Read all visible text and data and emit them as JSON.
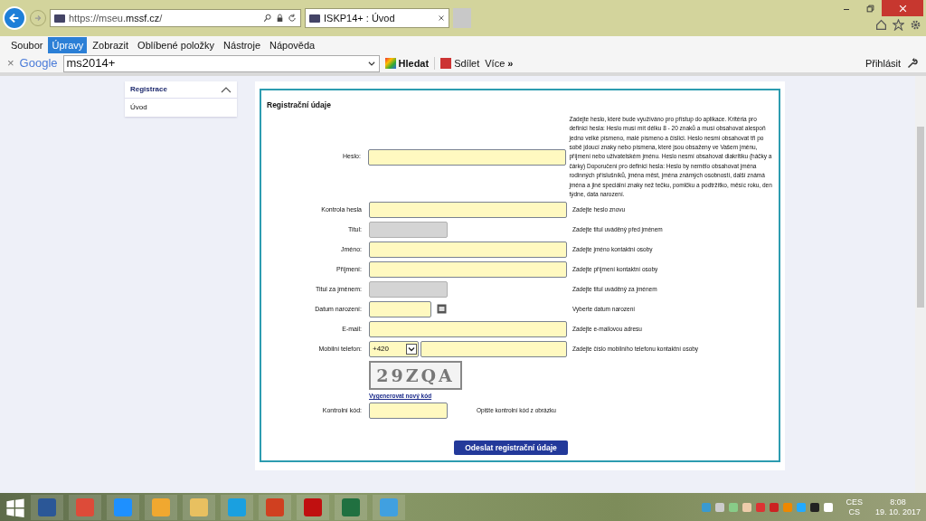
{
  "browser": {
    "url_prefix": "https://mseu.",
    "url_domain": "mssf.cz",
    "url_suffix": "/",
    "tab_title": "ISKP14+ : Úvod",
    "menu": [
      {
        "label": "Soubor",
        "selected": false
      },
      {
        "label": "Úpravy",
        "selected": true
      },
      {
        "label": "Zobrazit",
        "selected": false
      },
      {
        "label": "Oblíbené položky",
        "selected": false
      },
      {
        "label": "Nástroje",
        "selected": false
      },
      {
        "label": "Nápověda",
        "selected": false
      }
    ],
    "toolbar": {
      "close": "×",
      "brand": "Google",
      "query": "ms2014+",
      "search": "Hledat",
      "share": "Sdílet",
      "more": "Více",
      "more_arrows": "»",
      "login": "Přihlásit"
    }
  },
  "sidebar": {
    "title": "Registrace",
    "expanded": true,
    "items": [
      "Úvod"
    ]
  },
  "form": {
    "title": "Registrační údaje",
    "fields": [
      {
        "kind": "text",
        "label": "Heslo:",
        "help": "Zadejte heslo, které bude využíváno pro přístup do aplikace. Kritéria pro definici hesla: Heslo musí mít délku 8 - 20 znaků a musí obsahovat alespoň jedno velké písmeno, malé písmeno a číslici. Heslo nesmí obsahovat tři po sobě jdoucí znaky nebo písmena, které jsou obsaženy ve Vašem jménu, příjmení nebo uživatelském jménu. Heslo nesmí obsahovat diakritiku (háčky a čárky) Doporučení pro definici hesla: Heslo by nemělo obsahovat jména rodinných příslušníků, jména měst, jména známých osobností, další známá jména a jiné speciální znaky než tečku, pomlčku a podtržítko, měsíc roku, den týdne, data narození."
      },
      {
        "kind": "text",
        "label": "Kontrola hesla",
        "help": "Zadejte heslo znovu"
      },
      {
        "kind": "disabled",
        "label": "Titul:",
        "help": "Zadejte titul uváděný před jménem"
      },
      {
        "kind": "text",
        "label": "Jméno:",
        "help": "Zadejte jméno kontaktní osoby"
      },
      {
        "kind": "text",
        "label": "Příjmení:",
        "help": "Zadejte příjmení kontaktní osoby"
      },
      {
        "kind": "disabled",
        "label": "Titul za jménem:",
        "help": "Zadejte titul uváděný za jménem"
      },
      {
        "kind": "date",
        "label": "Datum narození:",
        "help": "Vyberte datum narození"
      },
      {
        "kind": "text",
        "label": "E-mail:",
        "help": "Zadejte e-mailovou adresu"
      },
      {
        "kind": "phone",
        "label": "Mobilní telefon:",
        "prefix": "+420",
        "help": "Zadejte číslo mobilního telefonu kontaktní osoby"
      }
    ],
    "captcha": {
      "code": "29ZQA",
      "regenerate": "Vygenerovat nový kód",
      "label": "Kontrolní kód:",
      "help": "Opište kontrolní kód z obrázku"
    },
    "submit": "Odeslat registrační údaje"
  },
  "taskbar": {
    "language_top": "CES",
    "language_bottom": "CS",
    "time": "8:08",
    "date": "19. 10. 2017"
  }
}
